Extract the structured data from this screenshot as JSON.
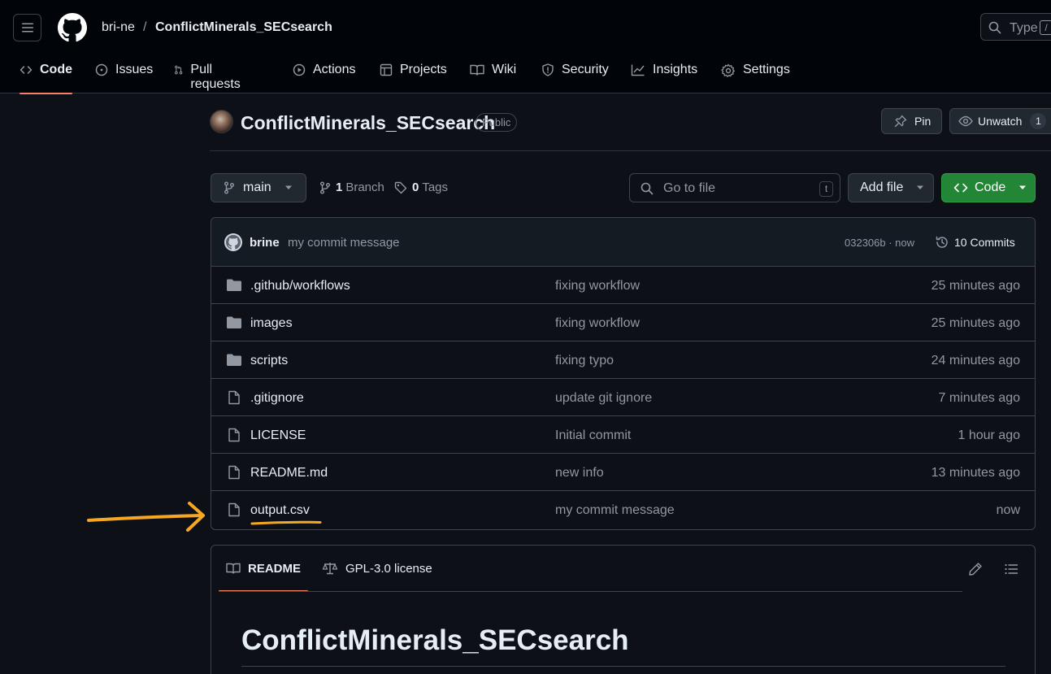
{
  "header": {
    "owner": "bri-ne",
    "separator": "/",
    "repo": "ConflictMinerals_SECsearch",
    "search_placeholder": "Type",
    "search_kbd": "/"
  },
  "nav_tabs": [
    {
      "label": "Code",
      "icon": "code-icon",
      "active": true
    },
    {
      "label": "Issues",
      "icon": "issue-icon"
    },
    {
      "label": "Pull requests",
      "icon": "pull-request-icon"
    },
    {
      "label": "Actions",
      "icon": "play-icon"
    },
    {
      "label": "Projects",
      "icon": "table-icon"
    },
    {
      "label": "Wiki",
      "icon": "book-icon"
    },
    {
      "label": "Security",
      "icon": "shield-icon"
    },
    {
      "label": "Insights",
      "icon": "graph-icon"
    },
    {
      "label": "Settings",
      "icon": "gear-icon"
    }
  ],
  "repo_header": {
    "title": "ConflictMinerals_SECsearch",
    "visibility": "Public",
    "pin_label": "Pin",
    "watch_label": "Unwatch",
    "watch_count": "1"
  },
  "controls": {
    "branch": "main",
    "branch_count": "1",
    "branch_label": "Branch",
    "tag_count": "0",
    "tag_label": "Tags",
    "goto_placeholder": "Go to file",
    "goto_kbd": "t",
    "add_file_label": "Add file",
    "code_label": "Code"
  },
  "latest_commit": {
    "author": "brine",
    "message": "my commit message",
    "hash_time": "032306b · now",
    "commits_count": "10",
    "commits_label": "Commits"
  },
  "files": [
    {
      "name": ".github/workflows",
      "type": "folder",
      "message": "fixing workflow",
      "age": "25 minutes ago"
    },
    {
      "name": "images",
      "type": "folder",
      "message": "fixing workflow",
      "age": "25 minutes ago"
    },
    {
      "name": "scripts",
      "type": "folder",
      "message": "fixing typo",
      "age": "24 minutes ago"
    },
    {
      "name": ".gitignore",
      "type": "file",
      "message": "update git ignore",
      "age": "7 minutes ago"
    },
    {
      "name": "LICENSE",
      "type": "file",
      "message": "Initial commit",
      "age": "1 hour ago"
    },
    {
      "name": "README.md",
      "type": "file",
      "message": "new info",
      "age": "13 minutes ago"
    },
    {
      "name": "output.csv",
      "type": "file",
      "message": "my commit message",
      "age": "now"
    }
  ],
  "annotation": {
    "color": "#f5a623"
  },
  "readme": {
    "tab_readme": "README",
    "tab_license": "GPL-3.0 license",
    "heading": "ConflictMinerals_SECsearch"
  },
  "colors": {
    "accent_underline": "#f78166",
    "code_button": "#238636",
    "background": "#0d1117"
  }
}
